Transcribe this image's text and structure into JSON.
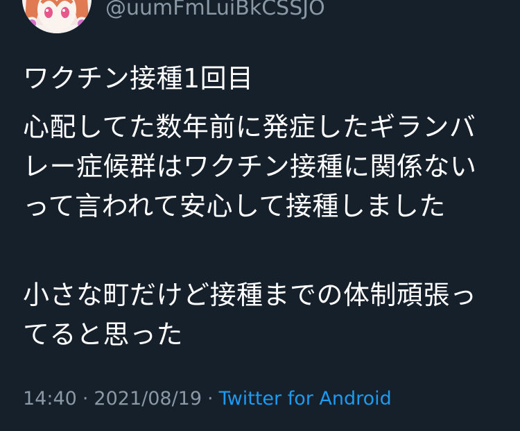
{
  "tweet": {
    "handle": "@uumFmLuiBkCSSJO",
    "paragraphs": [
      "ワクチン接種1回目",
      "心配してた数年前に発症したギランバレー症候群はワクチン接種に関係ないって言われて安心して接種しました",
      "小さな町だけど接種までの体制頑張ってると思った"
    ],
    "time": "14:40",
    "date": "2021/08/19",
    "separator": "·",
    "source": "Twitter for Android"
  },
  "colors": {
    "background": "#15202b",
    "text": "#ffffff",
    "secondary_text": "#8b98a5",
    "link": "#1d9bf0"
  }
}
